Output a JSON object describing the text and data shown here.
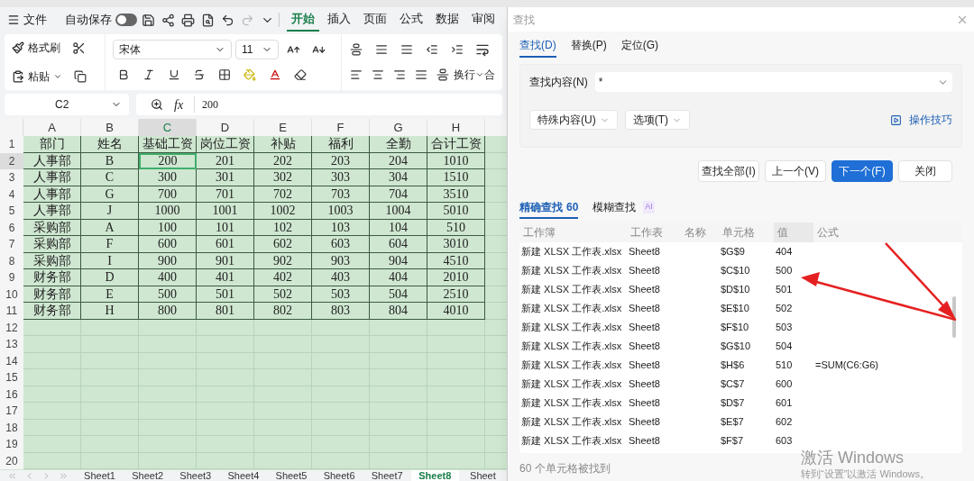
{
  "menu_bar": {
    "file_label": "文件",
    "autosave": {
      "label": "自动保存",
      "on": false
    },
    "tabs": [
      {
        "label": "开始",
        "selected": true
      },
      {
        "label": "插入",
        "selected": false
      },
      {
        "label": "页面",
        "selected": false
      },
      {
        "label": "公式",
        "selected": false
      },
      {
        "label": "数据",
        "selected": false
      },
      {
        "label": "审阅",
        "selected": false
      }
    ]
  },
  "ribbon": {
    "format_painter": "格式刷",
    "paste": "粘贴",
    "font_name": "宋体",
    "font_size": "11",
    "wrap": "换行",
    "merge": "合"
  },
  "formula_bar": {
    "name_box": "C2",
    "fx": "fx",
    "value": "200"
  },
  "sheet": {
    "columns": [
      {
        "label": "A",
        "selected": false
      },
      {
        "label": "B",
        "selected": false
      },
      {
        "label": "C",
        "selected": true
      },
      {
        "label": "D",
        "selected": false
      },
      {
        "label": "E",
        "selected": false
      },
      {
        "label": "F",
        "selected": false
      },
      {
        "label": "G",
        "selected": false
      },
      {
        "label": "H",
        "selected": false
      }
    ],
    "rows": [
      {
        "number": "1",
        "selected": false,
        "cells": [
          "部门",
          "姓名",
          "基础工资",
          "岗位工资",
          "补贴",
          "福利",
          "全勤",
          "合计工资"
        ]
      },
      {
        "number": "2",
        "selected": true,
        "cells": [
          "人事部",
          "B",
          "200",
          "201",
          "202",
          "203",
          "204",
          "1010"
        ]
      },
      {
        "number": "3",
        "selected": false,
        "cells": [
          "人事部",
          "C",
          "300",
          "301",
          "302",
          "303",
          "304",
          "1510"
        ]
      },
      {
        "number": "4",
        "selected": false,
        "cells": [
          "人事部",
          "G",
          "700",
          "701",
          "702",
          "703",
          "704",
          "3510"
        ]
      },
      {
        "number": "5",
        "selected": false,
        "cells": [
          "人事部",
          "J",
          "1000",
          "1001",
          "1002",
          "1003",
          "1004",
          "5010"
        ]
      },
      {
        "number": "6",
        "selected": false,
        "cells": [
          "采购部",
          "A",
          "100",
          "101",
          "102",
          "103",
          "104",
          "510"
        ]
      },
      {
        "number": "7",
        "selected": false,
        "cells": [
          "采购部",
          "F",
          "600",
          "601",
          "602",
          "603",
          "604",
          "3010"
        ]
      },
      {
        "number": "8",
        "selected": false,
        "cells": [
          "采购部",
          "I",
          "900",
          "901",
          "902",
          "903",
          "904",
          "4510"
        ]
      },
      {
        "number": "9",
        "selected": false,
        "cells": [
          "财务部",
          "D",
          "400",
          "401",
          "402",
          "403",
          "404",
          "2010"
        ]
      },
      {
        "number": "10",
        "selected": false,
        "cells": [
          "财务部",
          "E",
          "500",
          "501",
          "502",
          "503",
          "504",
          "2510"
        ]
      },
      {
        "number": "11",
        "selected": false,
        "cells": [
          "财务部",
          "H",
          "800",
          "801",
          "802",
          "803",
          "804",
          "4010"
        ]
      },
      {
        "number": "12",
        "selected": false,
        "cells": []
      },
      {
        "number": "13",
        "selected": false,
        "cells": []
      },
      {
        "number": "14",
        "selected": false,
        "cells": []
      },
      {
        "number": "15",
        "selected": false,
        "cells": []
      },
      {
        "number": "16",
        "selected": false,
        "cells": []
      },
      {
        "number": "17",
        "selected": false,
        "cells": []
      },
      {
        "number": "18",
        "selected": false,
        "cells": []
      },
      {
        "number": "19",
        "selected": false,
        "cells": []
      },
      {
        "number": "20",
        "selected": false,
        "cells": []
      }
    ],
    "sheet_tabs": [
      {
        "label": "Sheet1",
        "selected": false
      },
      {
        "label": "Sheet2",
        "selected": false
      },
      {
        "label": "Sheet3",
        "selected": false
      },
      {
        "label": "Sheet4",
        "selected": false
      },
      {
        "label": "Sheet5",
        "selected": false
      },
      {
        "label": "Sheet6",
        "selected": false
      },
      {
        "label": "Sheet7",
        "selected": false
      },
      {
        "label": "Sheet8",
        "selected": true
      },
      {
        "label": "Sheet",
        "selected": false
      }
    ]
  },
  "dialog": {
    "title": "查找",
    "tabs": [
      {
        "label": "查找(D)",
        "selected": true
      },
      {
        "label": "替换(P)",
        "selected": false
      },
      {
        "label": "定位(G)",
        "selected": false
      }
    ],
    "find_label": "查找内容(N)",
    "find_value": "*",
    "special_button": "特殊内容(U)",
    "options_button": "选项(T)",
    "tips_link": "操作技巧",
    "buttons": [
      {
        "label": "查找全部(I)",
        "kind": "normal"
      },
      {
        "label": "上一个(V)",
        "kind": "normal"
      },
      {
        "label": "下一个(F)",
        "kind": "primary"
      },
      {
        "label": "关闭",
        "kind": "normal"
      }
    ],
    "result_tabs": [
      {
        "label": "精确查找",
        "count": "60",
        "selected": true
      },
      {
        "label": "模糊查找",
        "badge": "AI",
        "selected": false
      }
    ],
    "results": {
      "columns": [
        "工作簿",
        "工作表",
        "名称",
        "单元格",
        "值",
        "公式"
      ],
      "rows": [
        [
          "新建 XLSX 工作表.xlsx",
          "Sheet8",
          "",
          "$G$9",
          "404",
          ""
        ],
        [
          "新建 XLSX 工作表.xlsx",
          "Sheet8",
          "",
          "$C$10",
          "500",
          ""
        ],
        [
          "新建 XLSX 工作表.xlsx",
          "Sheet8",
          "",
          "$D$10",
          "501",
          ""
        ],
        [
          "新建 XLSX 工作表.xlsx",
          "Sheet8",
          "",
          "$E$10",
          "502",
          ""
        ],
        [
          "新建 XLSX 工作表.xlsx",
          "Sheet8",
          "",
          "$F$10",
          "503",
          ""
        ],
        [
          "新建 XLSX 工作表.xlsx",
          "Sheet8",
          "",
          "$G$10",
          "504",
          ""
        ],
        [
          "新建 XLSX 工作表.xlsx",
          "Sheet8",
          "",
          "$H$6",
          "510",
          "=SUM(C6:G6)"
        ],
        [
          "新建 XLSX 工作表.xlsx",
          "Sheet8",
          "",
          "$C$7",
          "600",
          ""
        ],
        [
          "新建 XLSX 工作表.xlsx",
          "Sheet8",
          "",
          "$D$7",
          "601",
          ""
        ],
        [
          "新建 XLSX 工作表.xlsx",
          "Sheet8",
          "",
          "$E$7",
          "602",
          ""
        ],
        [
          "新建 XLSX 工作表.xlsx",
          "Sheet8",
          "",
          "$F$7",
          "603",
          ""
        ]
      ]
    },
    "status": "60 个单元格被找到"
  },
  "activation_notice": {
    "title": "激活 Windows",
    "hint": "转到“设置”以激活 Windows。"
  }
}
